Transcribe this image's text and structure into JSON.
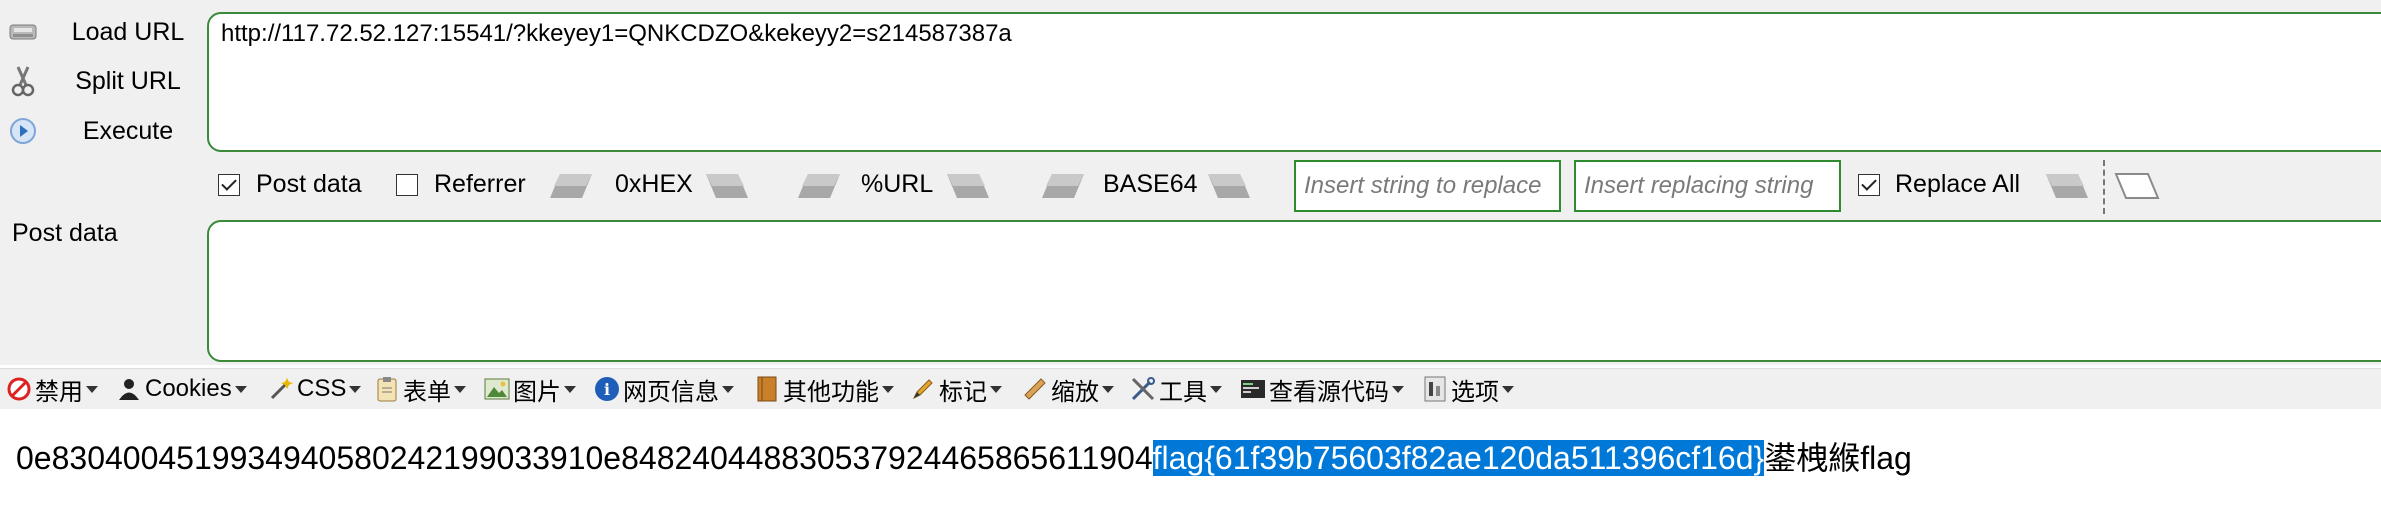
{
  "sidebar": {
    "load_url": "Load URL",
    "split_url": "Split URL",
    "execute": "Execute"
  },
  "url_field": {
    "value": "http://117.72.52.127:15541/?kkeyey1=QNKCDZO&kekeyy2=s214587387a"
  },
  "options": {
    "post_data": {
      "label": "Post data",
      "checked": true
    },
    "referrer": {
      "label": "Referrer",
      "checked": false
    },
    "hex_label": "0xHEX",
    "url_label": "%URL",
    "base64_label": "BASE64",
    "replace_placeholder": "Insert string to replace",
    "replacing_placeholder": "Insert replacing string",
    "replace_all": {
      "label": "Replace All",
      "checked": true
    }
  },
  "post_data_label": "Post data",
  "toolbar": {
    "disable": "禁用",
    "cookies": "Cookies",
    "css": "CSS",
    "forms": "表单",
    "images": "图片",
    "info": "网页信息",
    "misc": "其他功能",
    "outline": "标记",
    "resize": "缩放",
    "tools": "工具",
    "view_source": "查看源代码",
    "options": "选项"
  },
  "page_content": {
    "prefix": "0e830400451993494058024219903391 0e8482404488305379244658656119 04",
    "prefix_exact": "0e8304004519934940580242199033910e848240448830537924465865611904",
    "flag_selected": "flag{61f39b75603f82ae120da511396cf16d}",
    "suffix": "鍙栧緱flag"
  },
  "colors": {
    "accent_green": "#3a8a3a",
    "selection_blue": "#0078d7",
    "panel_bg": "#f0f0f0"
  }
}
